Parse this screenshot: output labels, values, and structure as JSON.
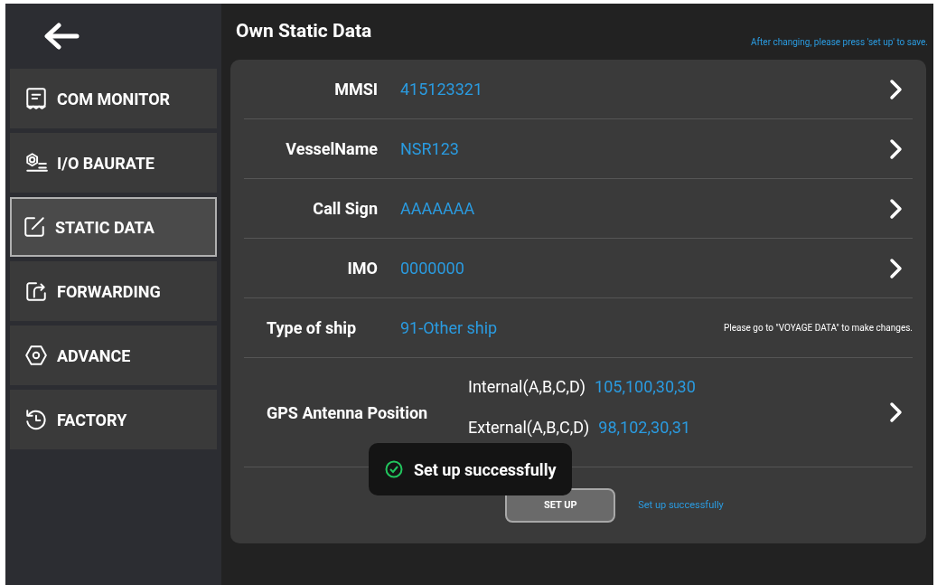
{
  "sidebar": {
    "items": [
      {
        "label": "COM MONITOR",
        "selected": false
      },
      {
        "label": "I/O BAURATE",
        "selected": false
      },
      {
        "label": "STATIC DATA",
        "selected": true
      },
      {
        "label": "FORWARDING",
        "selected": false
      },
      {
        "label": "ADVANCE",
        "selected": false
      },
      {
        "label": "FACTORY",
        "selected": false
      }
    ]
  },
  "header": {
    "title": "Own Static Data",
    "hint": "After changing, please press 'set up' to save."
  },
  "fields": [
    {
      "kind": "nav",
      "label": "MMSI",
      "value": "415123321"
    },
    {
      "kind": "nav",
      "label": "VesselName",
      "value": "NSR123"
    },
    {
      "kind": "nav",
      "label": "Call Sign",
      "value": "AAAAAAA"
    },
    {
      "kind": "nav",
      "label": "IMO",
      "value": "0000000"
    },
    {
      "kind": "readonly",
      "label": "Type of ship",
      "value": "91-Other ship",
      "note": "Please go to \"VOYAGE DATA\" to make changes."
    },
    {
      "kind": "antenna",
      "label": "GPS Antenna Position",
      "lines": [
        {
          "label": "Internal(A,B,C,D)",
          "value": "105,100,30,30"
        },
        {
          "label": "External(A,B,C,D)",
          "value": "98,102,30,31"
        }
      ]
    }
  ],
  "setup_button": "SET UP",
  "status": "Set up successfully",
  "toast": {
    "text": "Set up successfully"
  }
}
